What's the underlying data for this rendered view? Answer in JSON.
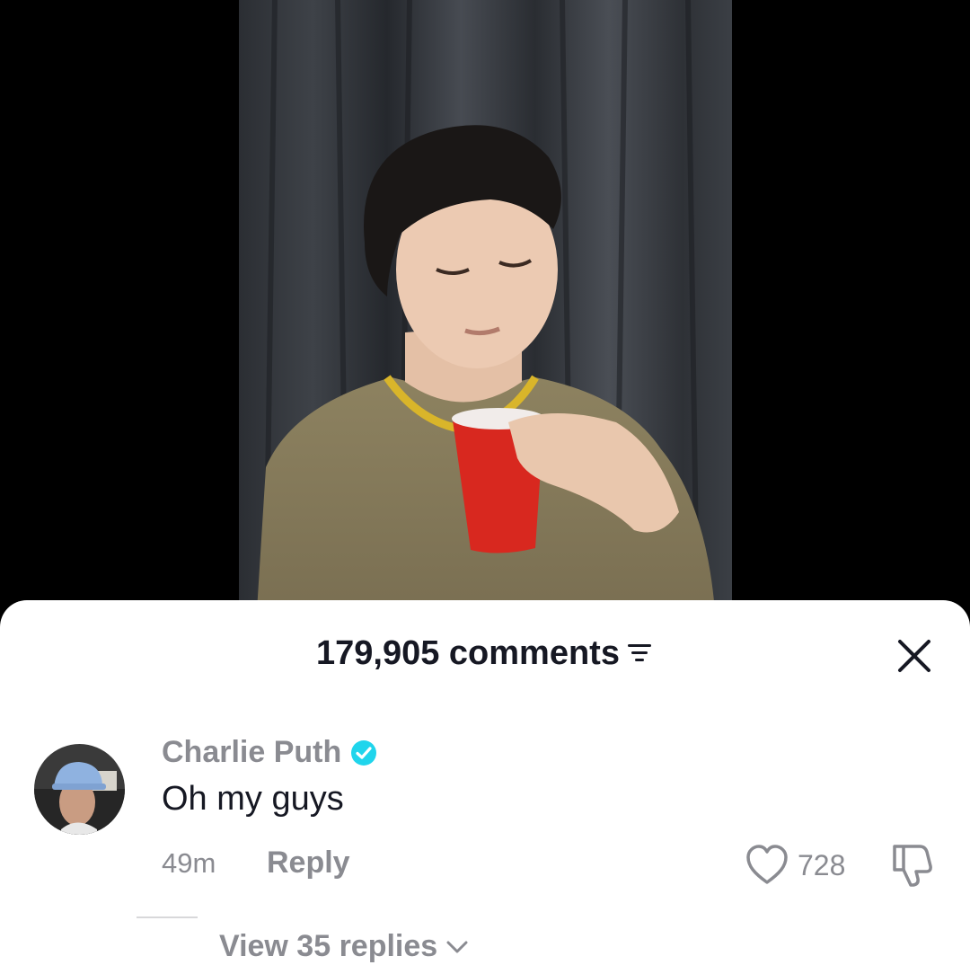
{
  "comments_panel": {
    "count_label": "179,905 comments",
    "filter_icon": "filter-lines-icon",
    "close_icon": "close-icon"
  },
  "comment": {
    "username": "Charlie Puth",
    "verified": true,
    "text": "Oh my guys",
    "time": "49m",
    "reply_label": "Reply",
    "like_count": "728",
    "view_replies_label": "View 35 replies"
  },
  "colors": {
    "text_primary": "#161823",
    "text_secondary": "#8a8b91",
    "verified_badge": "#20D5EC",
    "background": "#000000"
  }
}
